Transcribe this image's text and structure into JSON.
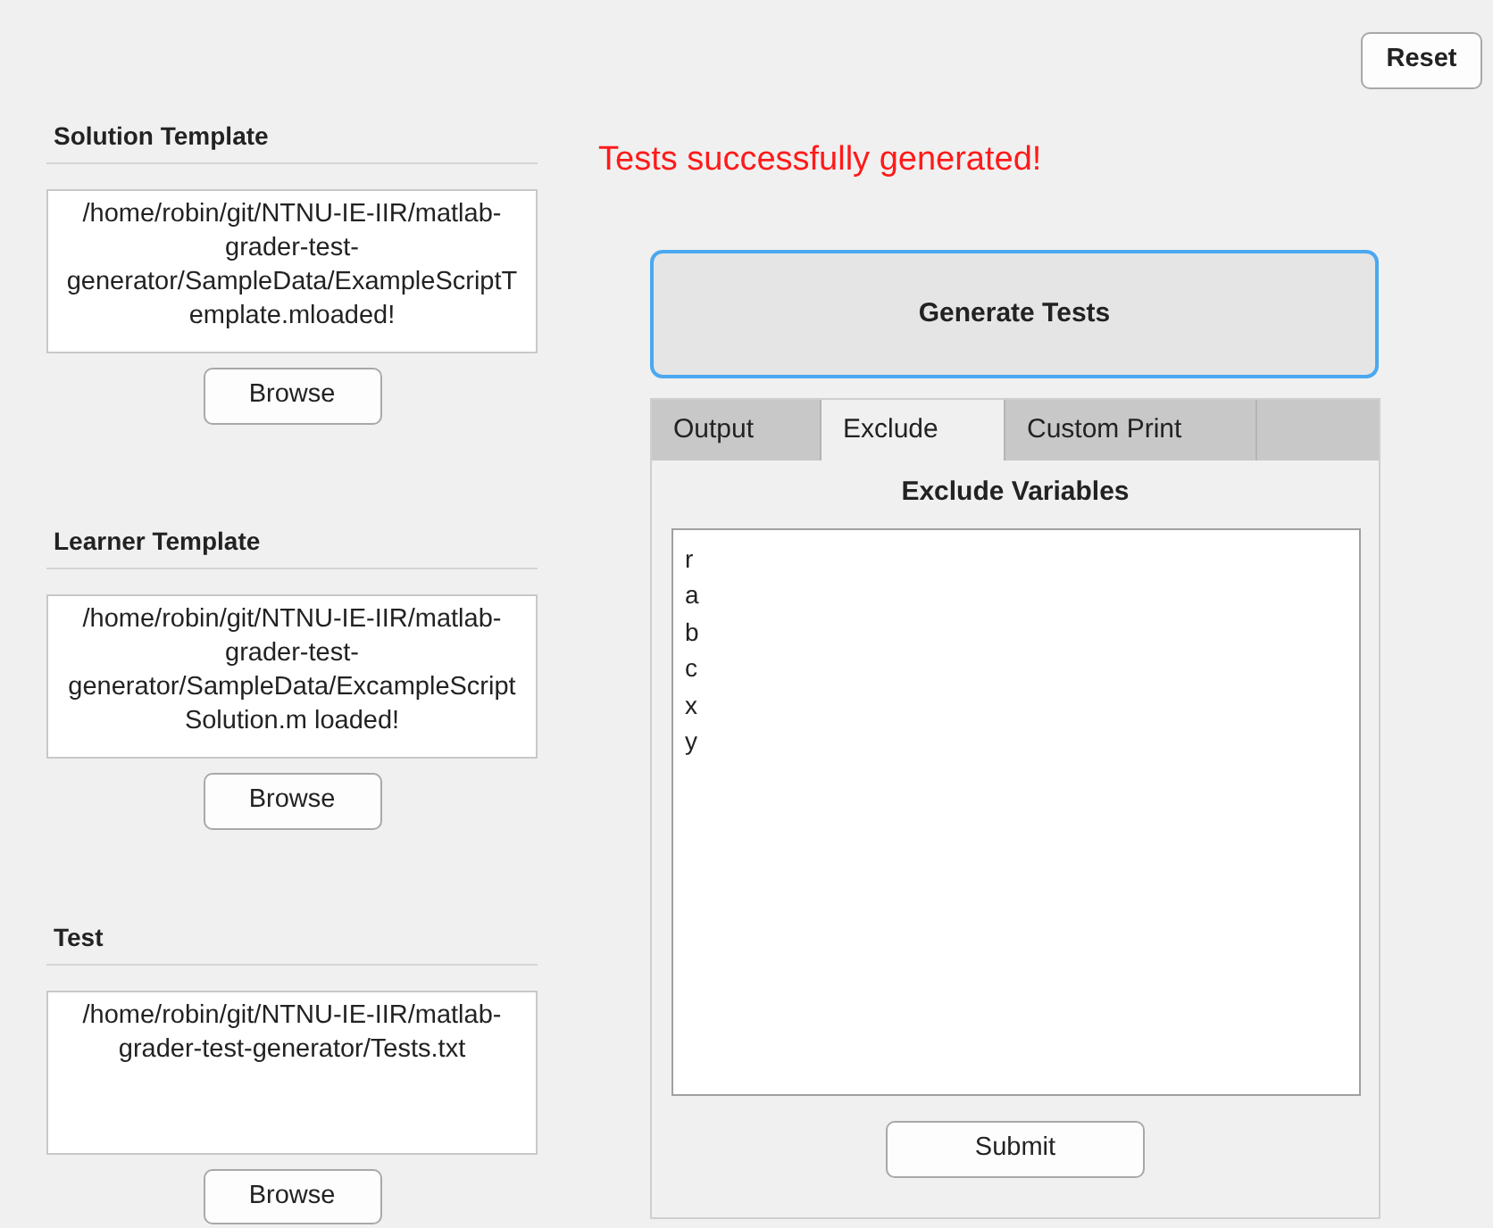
{
  "reset_button": "Reset",
  "sections": [
    {
      "title": "Solution Template",
      "path": "/home/robin/git/NTNU-IE-IIR/matlab-grader-test-generator/SampleData/ExampleScriptTemplate.mloaded!",
      "button": "Browse"
    },
    {
      "title": "Learner Template",
      "path": "/home/robin/git/NTNU-IE-IIR/matlab-grader-test-generator/SampleData/ExcampleScriptSolution.m loaded!",
      "button": "Browse"
    },
    {
      "title": "Test",
      "path": "/home/robin/git/NTNU-IE-IIR/matlab-grader-test-generator/Tests.txt",
      "button": "Browse"
    }
  ],
  "status_message": "Tests successfully generated!",
  "generate_button": "Generate Tests",
  "tabs": [
    {
      "label": "Output",
      "selected": false
    },
    {
      "label": "Exclude",
      "selected": true
    },
    {
      "label": "Custom Print",
      "selected": false
    }
  ],
  "exclude_panel": {
    "title": "Exclude Variables",
    "variables": [
      "r",
      "a",
      "b",
      "c",
      "x",
      "y"
    ],
    "submit_button": "Submit"
  }
}
